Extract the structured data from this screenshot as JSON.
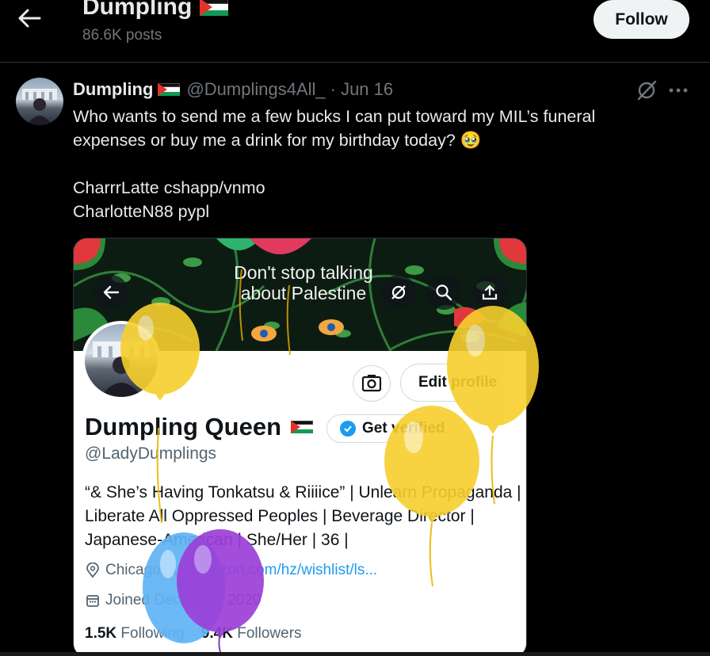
{
  "header": {
    "title": "Dumpling",
    "post_count": "86.6K posts",
    "follow_label": "Follow"
  },
  "tweet": {
    "name": "Dumpling",
    "handle": "@Dumplings4All_",
    "date": "· Jun 16",
    "text": "Who wants to send me a few bucks I can put toward my MIL’s funeral\nexpenses or buy me a drink for my birthday today? 🥹\n\nCharrrLatte cshapp/vnmo\nCharlotteN88 pypl"
  },
  "embedded_profile": {
    "banner_text": "Don't stop talking about Palestine",
    "edit_profile_label": "Edit profile",
    "name": "Dumpling Queen",
    "get_verified_label": "Get verified",
    "handle": "@LadyDumplings",
    "bio": "“& She’s Having Tonkatsu & Riiiice” | Unlearn Propaganda | Liberate All Oppressed Peoples | Beverage Director | Japanese-American | She/Her | 36 |",
    "location": "Chicago",
    "link": "amazon.com/hz/wishlist/ls...",
    "joined": "Joined December 2020",
    "following_count": "1.5K",
    "following_label": "Following",
    "followers_count": "9.4K",
    "followers_label": "Followers"
  },
  "colors": {
    "background": "#000000",
    "accent_blue": "#1d9bf0",
    "muted_text": "#71767b",
    "balloon_yellow": "#f7cf2d",
    "balloon_blue": "#5fb3f5",
    "balloon_purple": "#9b3fd8"
  }
}
